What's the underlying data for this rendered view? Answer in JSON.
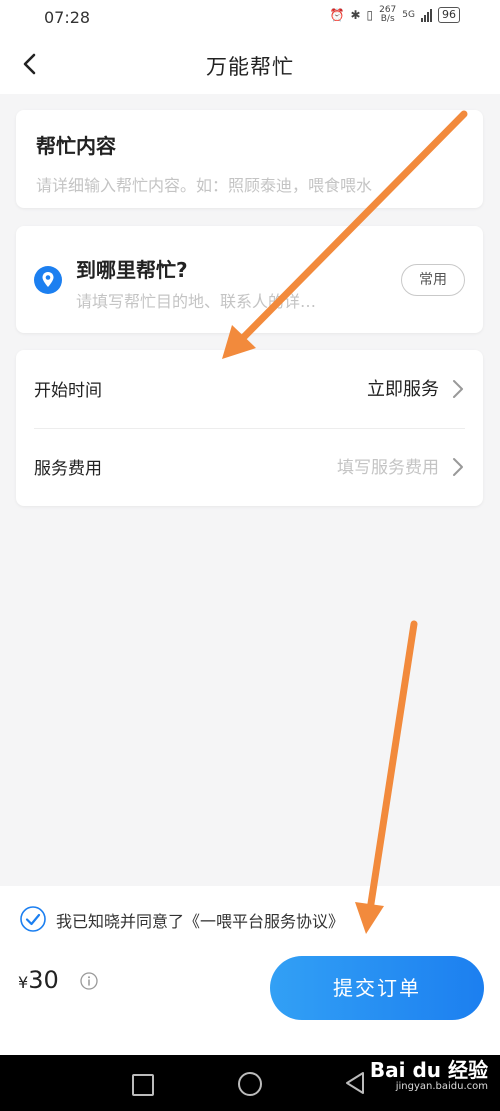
{
  "status": {
    "time": "07:28",
    "net_speed_value": "267",
    "net_speed_unit": "B/s",
    "network": "5G",
    "battery": "96"
  },
  "header": {
    "title": "万能帮忙"
  },
  "help_content": {
    "title": "帮忙内容",
    "placeholder": "请详细输入帮忙内容。如：照顾泰迪，喂食喂水"
  },
  "location": {
    "title": "到哪里帮忙?",
    "placeholder": "请填写帮忙目的地、联系人的详…",
    "common_label": "常用"
  },
  "details": {
    "start_time_label": "开始时间",
    "start_time_value": "立即服务",
    "fee_label": "服务费用",
    "fee_placeholder": "填写服务费用"
  },
  "footer": {
    "agreement": "我已知晓并同意了《一喂平台服务协议》",
    "currency": "¥",
    "price": "30",
    "submit_label": "提交订单"
  },
  "watermark": {
    "brand": "Bai du 经验",
    "sub": "jingyan.baidu.com"
  },
  "colors": {
    "accent": "#1c7ff0",
    "arrow": "#f28a3c",
    "placeholder": "#c4c4c4"
  }
}
